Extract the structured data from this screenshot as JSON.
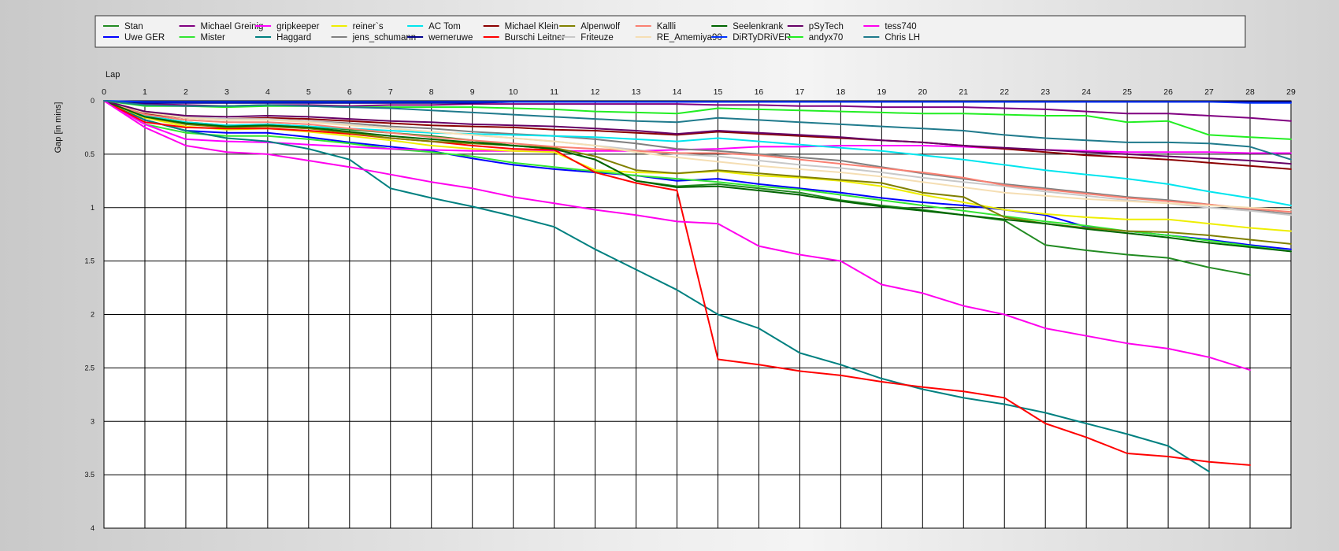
{
  "chart_data": {
    "type": "line",
    "xlabel": "Lap",
    "ylabel": "Gap [in mins]",
    "xlim": [
      0,
      29
    ],
    "ylim": [
      0,
      4
    ],
    "y_inverted": true,
    "grid": true,
    "legend_position": "top",
    "x": [
      0,
      1,
      2,
      3,
      4,
      5,
      6,
      7,
      8,
      9,
      10,
      11,
      12,
      13,
      14,
      15,
      16,
      17,
      18,
      19,
      20,
      21,
      22,
      23,
      24,
      25,
      26,
      27,
      28,
      29
    ],
    "x_ticks": [
      0,
      1,
      2,
      3,
      4,
      5,
      6,
      7,
      8,
      9,
      10,
      11,
      12,
      13,
      14,
      15,
      16,
      17,
      18,
      19,
      20,
      21,
      22,
      23,
      24,
      25,
      26,
      27,
      28,
      29
    ],
    "y_ticks": [
      0,
      0.5,
      1,
      1.5,
      2,
      2.5,
      3,
      3.5,
      4
    ],
    "y_tick_labels": [
      "0",
      "0.5",
      "1",
      "1.5",
      "2",
      "2.5",
      "3",
      "3.5",
      "4"
    ],
    "series": [
      {
        "name": "Stan",
        "color": "#228B22",
        "values": [
          0,
          0.14,
          0.2,
          0.23,
          0.22,
          0.24,
          0.27,
          0.3,
          0.33,
          0.37,
          0.42,
          0.45,
          0.55,
          0.75,
          0.8,
          0.78,
          0.82,
          0.86,
          0.93,
          0.98,
          1.02,
          1.07,
          1.12,
          1.35,
          1.4,
          1.44,
          1.47,
          1.56,
          1.63
        ]
      },
      {
        "name": "Uwe GER",
        "color": "#0000FF",
        "values": [
          0,
          0.18,
          0.28,
          0.3,
          0.3,
          0.34,
          0.39,
          0.43,
          0.47,
          0.54,
          0.6,
          0.64,
          0.67,
          0.7,
          0.75,
          0.73,
          0.78,
          0.82,
          0.86,
          0.91,
          0.95,
          0.98,
          1.02,
          1.07,
          1.18,
          1.22,
          1.26,
          1.3,
          1.35,
          1.39
        ]
      },
      {
        "name": "Michael Greinig",
        "color": "#800080",
        "values": [
          0,
          0.03,
          0.04,
          0.05,
          0.04,
          0.04,
          0.05,
          0.04,
          0.04,
          0.03,
          0.03,
          0.03,
          0.03,
          0.03,
          0.03,
          0.04,
          0.04,
          0.05,
          0.05,
          0.06,
          0.06,
          0.06,
          0.07,
          0.08,
          0.1,
          0.12,
          0.12,
          0.14,
          0.16,
          0.19
        ]
      },
      {
        "name": "Mister",
        "color": "#33E633",
        "values": [
          0,
          0.22,
          0.3,
          0.33,
          0.33,
          0.36,
          0.4,
          0.45,
          0.48,
          0.52,
          0.58,
          0.62,
          0.66,
          0.7,
          0.73,
          0.76,
          0.8,
          0.83,
          0.88,
          0.93,
          0.98,
          1.03,
          1.08,
          1.13,
          1.17,
          1.22,
          1.26,
          1.31,
          1.36,
          1.41
        ]
      },
      {
        "name": "gripkeeper",
        "color": "#FF00FF",
        "values": [
          0,
          0.22,
          0.36,
          0.38,
          0.39,
          0.41,
          0.43,
          0.45,
          0.46,
          0.47,
          0.47,
          0.47,
          0.47,
          0.47,
          0.46,
          0.45,
          0.43,
          0.43,
          0.42,
          0.42,
          0.42,
          0.43,
          0.45,
          0.46,
          0.47,
          0.48,
          0.48,
          0.48,
          0.49,
          0.49
        ]
      },
      {
        "name": "Haggard",
        "color": "#008080",
        "values": [
          0,
          0.18,
          0.28,
          0.35,
          0.38,
          0.45,
          0.55,
          0.82,
          0.91,
          0.99,
          1.08,
          1.18,
          1.39,
          1.58,
          1.77,
          2.0,
          2.13,
          2.36,
          2.47,
          2.6,
          2.7,
          2.78,
          2.84,
          2.92,
          3.02,
          3.12,
          3.23,
          3.47
        ]
      },
      {
        "name": "reiner`s",
        "color": "#EEEE00",
        "values": [
          0,
          0.16,
          0.24,
          0.27,
          0.26,
          0.29,
          0.33,
          0.37,
          0.42,
          0.45,
          0.47,
          0.48,
          0.65,
          0.67,
          0.68,
          0.66,
          0.7,
          0.72,
          0.75,
          0.8,
          0.88,
          0.95,
          1.02,
          1.06,
          1.09,
          1.11,
          1.11,
          1.15,
          1.19,
          1.22
        ]
      },
      {
        "name": "jens_schumann",
        "color": "#808080",
        "values": [
          0,
          0.12,
          0.16,
          0.18,
          0.17,
          0.19,
          0.21,
          0.24,
          0.26,
          0.29,
          0.31,
          0.33,
          0.36,
          0.4,
          0.45,
          0.47,
          0.5,
          0.53,
          0.56,
          0.62,
          0.68,
          0.73,
          0.78,
          0.82,
          0.86,
          0.9,
          0.93,
          0.97,
          1.02,
          1.06
        ]
      },
      {
        "name": "AC Tom",
        "color": "#00E5EE",
        "values": [
          0,
          0.14,
          0.2,
          0.23,
          0.22,
          0.24,
          0.26,
          0.28,
          0.3,
          0.31,
          0.32,
          0.33,
          0.34,
          0.36,
          0.38,
          0.35,
          0.38,
          0.41,
          0.44,
          0.47,
          0.51,
          0.55,
          0.6,
          0.65,
          0.69,
          0.73,
          0.78,
          0.85,
          0.91,
          0.98
        ]
      },
      {
        "name": "werneruwe",
        "color": "#00008B",
        "values": [
          0,
          0.02,
          0.02,
          0.02,
          0.02,
          0.02,
          0.02,
          0.02,
          0.02,
          0.02,
          0.01,
          0.01,
          0.01,
          0.01,
          0.01,
          0.01,
          0.01,
          0.01,
          0.01,
          0.01,
          0.01,
          0.01,
          0.01,
          0.01,
          0.01,
          0.01,
          0.01,
          0.01,
          0.01,
          0.01
        ]
      },
      {
        "name": "Michael Klein",
        "color": "#8B0000",
        "values": [
          0,
          0.12,
          0.16,
          0.17,
          0.16,
          0.17,
          0.19,
          0.21,
          0.23,
          0.24,
          0.25,
          0.27,
          0.28,
          0.3,
          0.32,
          0.29,
          0.31,
          0.33,
          0.35,
          0.37,
          0.39,
          0.42,
          0.45,
          0.48,
          0.51,
          0.53,
          0.55,
          0.58,
          0.61,
          0.64
        ]
      },
      {
        "name": "Burschi Leitner",
        "color": "#FF0000",
        "values": [
          0,
          0.2,
          0.25,
          0.26,
          0.26,
          0.28,
          0.31,
          0.35,
          0.38,
          0.42,
          0.45,
          0.46,
          0.67,
          0.77,
          0.84,
          2.42,
          2.47,
          2.53,
          2.57,
          2.63,
          2.68,
          2.72,
          2.78,
          3.02,
          3.15,
          3.3,
          3.33,
          3.38,
          3.41
        ]
      },
      {
        "name": "Alpenwolf",
        "color": "#808000",
        "values": [
          0,
          0.15,
          0.22,
          0.25,
          0.24,
          0.26,
          0.3,
          0.35,
          0.38,
          0.4,
          0.42,
          0.44,
          0.52,
          0.65,
          0.68,
          0.65,
          0.68,
          0.71,
          0.74,
          0.77,
          0.86,
          0.9,
          1.09,
          1.15,
          1.19,
          1.22,
          1.23,
          1.26,
          1.3,
          1.34
        ]
      },
      {
        "name": "Friteuze",
        "color": "#C8C8C8",
        "values": [
          0,
          0.1,
          0.15,
          0.17,
          0.17,
          0.19,
          0.22,
          0.26,
          0.29,
          0.32,
          0.35,
          0.38,
          0.42,
          0.46,
          0.5,
          0.52,
          0.56,
          0.6,
          0.63,
          0.67,
          0.72,
          0.76,
          0.8,
          0.85,
          0.89,
          0.93,
          0.96,
          1.0,
          1.03,
          1.07
        ]
      },
      {
        "name": "Kallli",
        "color": "#FA8072",
        "values": [
          0,
          0.13,
          0.18,
          0.2,
          0.2,
          0.22,
          0.26,
          0.3,
          0.34,
          0.37,
          0.4,
          0.43,
          0.45,
          0.47,
          0.49,
          0.49,
          0.51,
          0.55,
          0.59,
          0.63,
          0.67,
          0.72,
          0.79,
          0.83,
          0.87,
          0.91,
          0.94,
          0.97,
          1.01,
          1.04
        ]
      },
      {
        "name": "RE_Amemiya90",
        "color": "#F5DEB3",
        "values": [
          0,
          0.11,
          0.16,
          0.18,
          0.18,
          0.2,
          0.23,
          0.26,
          0.29,
          0.32,
          0.35,
          0.38,
          0.42,
          0.48,
          0.53,
          0.57,
          0.61,
          0.64,
          0.67,
          0.71,
          0.76,
          0.81,
          0.86,
          0.89,
          0.92,
          0.94,
          0.96,
          0.98,
          1.0,
          1.02
        ]
      },
      {
        "name": "Seelenkrank",
        "color": "#006400",
        "values": [
          0,
          0.15,
          0.21,
          0.24,
          0.23,
          0.25,
          0.29,
          0.33,
          0.36,
          0.39,
          0.42,
          0.45,
          0.55,
          0.75,
          0.81,
          0.8,
          0.84,
          0.88,
          0.94,
          0.99,
          1.03,
          1.07,
          1.11,
          1.15,
          1.2,
          1.24,
          1.28,
          1.33,
          1.37,
          1.41
        ]
      },
      {
        "name": "DiRTyDRiVER",
        "color": "#0033FF",
        "values": [
          0,
          0.01,
          0.01,
          0.01,
          0.01,
          0.01,
          0.01,
          0.01,
          0.01,
          0.01,
          0.01,
          0.01,
          0.01,
          0.01,
          0.01,
          0.01,
          0.01,
          0.01,
          0.01,
          0.01,
          0.01,
          0.01,
          0.01,
          0.01,
          0.01,
          0.01,
          0.01,
          0.01,
          0.02,
          0.02
        ]
      },
      {
        "name": "pSyTech",
        "color": "#660066",
        "values": [
          0,
          0.1,
          0.14,
          0.15,
          0.14,
          0.15,
          0.17,
          0.19,
          0.2,
          0.22,
          0.23,
          0.24,
          0.26,
          0.28,
          0.31,
          0.28,
          0.3,
          0.32,
          0.34,
          0.37,
          0.39,
          0.42,
          0.44,
          0.46,
          0.48,
          0.5,
          0.52,
          0.54,
          0.56,
          0.59
        ]
      },
      {
        "name": "andyx70",
        "color": "#22EE22",
        "values": [
          0,
          0.05,
          0.05,
          0.06,
          0.05,
          0.05,
          0.06,
          0.06,
          0.06,
          0.06,
          0.07,
          0.08,
          0.1,
          0.11,
          0.12,
          0.07,
          0.08,
          0.09,
          0.1,
          0.11,
          0.12,
          0.12,
          0.13,
          0.14,
          0.14,
          0.2,
          0.19,
          0.32,
          0.34,
          0.36
        ]
      },
      {
        "name": "tess740",
        "color": "#FF00EE",
        "values": [
          0,
          0.25,
          0.42,
          0.48,
          0.5,
          0.56,
          0.62,
          0.69,
          0.76,
          0.82,
          0.9,
          0.96,
          1.02,
          1.07,
          1.13,
          1.15,
          1.36,
          1.44,
          1.5,
          1.72,
          1.8,
          1.92,
          2.0,
          2.13,
          2.2,
          2.27,
          2.32,
          2.4,
          2.52
        ]
      },
      {
        "name": "Chris LH",
        "color": "#1F7A8C",
        "values": [
          0,
          0.04,
          0.05,
          0.05,
          0.04,
          0.05,
          0.06,
          0.07,
          0.09,
          0.11,
          0.13,
          0.15,
          0.17,
          0.19,
          0.2,
          0.16,
          0.18,
          0.2,
          0.22,
          0.24,
          0.26,
          0.28,
          0.32,
          0.35,
          0.37,
          0.39,
          0.39,
          0.4,
          0.43,
          0.55
        ]
      }
    ]
  }
}
